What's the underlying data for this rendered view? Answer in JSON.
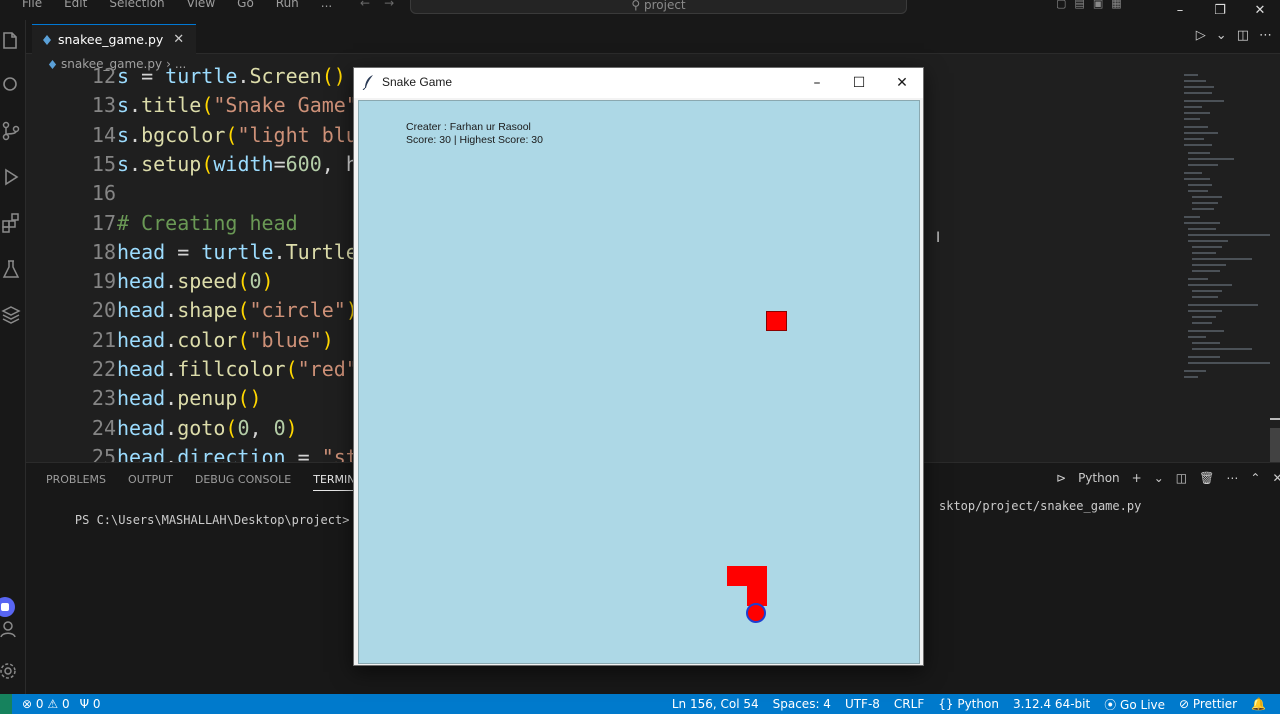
{
  "menubar": {
    "items": [
      "File",
      "Edit",
      "Selection",
      "View",
      "Go",
      "Run",
      "..."
    ],
    "search_text": "project"
  },
  "tab": {
    "filename": "snakee_game.py"
  },
  "breadcrumb": {
    "file": "snakee_game.py",
    "rest": "..."
  },
  "code_lines": [
    {
      "num": "12",
      "tokens": [
        {
          "t": "s",
          "c": "var"
        },
        {
          "t": " = ",
          "c": ""
        },
        {
          "t": "turtle",
          "c": "var"
        },
        {
          "t": ".",
          "c": ""
        },
        {
          "t": "Screen",
          "c": "fn"
        },
        {
          "t": "()",
          "c": "br1"
        }
      ]
    },
    {
      "num": "13",
      "tokens": [
        {
          "t": "s",
          "c": "var"
        },
        {
          "t": ".",
          "c": ""
        },
        {
          "t": "title",
          "c": "fn"
        },
        {
          "t": "(",
          "c": "br1"
        },
        {
          "t": "\"Snake Game\"",
          "c": "str"
        }
      ]
    },
    {
      "num": "14",
      "tokens": [
        {
          "t": "s",
          "c": "var"
        },
        {
          "t": ".",
          "c": ""
        },
        {
          "t": "bgcolor",
          "c": "fn"
        },
        {
          "t": "(",
          "c": "br1"
        },
        {
          "t": "\"light blu",
          "c": "str"
        }
      ]
    },
    {
      "num": "15",
      "tokens": [
        {
          "t": "s",
          "c": "var"
        },
        {
          "t": ".",
          "c": ""
        },
        {
          "t": "setup",
          "c": "fn"
        },
        {
          "t": "(",
          "c": "br1"
        },
        {
          "t": "width",
          "c": "var"
        },
        {
          "t": "=",
          "c": ""
        },
        {
          "t": "600",
          "c": "num"
        },
        {
          "t": ", h",
          "c": ""
        }
      ]
    },
    {
      "num": "16",
      "tokens": []
    },
    {
      "num": "17",
      "tokens": [
        {
          "t": "# Creating head",
          "c": "cmt"
        }
      ]
    },
    {
      "num": "18",
      "tokens": [
        {
          "t": "head",
          "c": "var"
        },
        {
          "t": " = ",
          "c": ""
        },
        {
          "t": "turtle",
          "c": "var"
        },
        {
          "t": ".",
          "c": ""
        },
        {
          "t": "Turtle",
          "c": "fn"
        }
      ]
    },
    {
      "num": "19",
      "tokens": [
        {
          "t": "head",
          "c": "var"
        },
        {
          "t": ".",
          "c": ""
        },
        {
          "t": "speed",
          "c": "fn"
        },
        {
          "t": "(",
          "c": "br1"
        },
        {
          "t": "0",
          "c": "num"
        },
        {
          "t": ")",
          "c": "br1"
        }
      ]
    },
    {
      "num": "20",
      "tokens": [
        {
          "t": "head",
          "c": "var"
        },
        {
          "t": ".",
          "c": ""
        },
        {
          "t": "shape",
          "c": "fn"
        },
        {
          "t": "(",
          "c": "br1"
        },
        {
          "t": "\"circle\"",
          "c": "str"
        },
        {
          "t": ")",
          "c": "br1"
        }
      ]
    },
    {
      "num": "21",
      "tokens": [
        {
          "t": "head",
          "c": "var"
        },
        {
          "t": ".",
          "c": ""
        },
        {
          "t": "color",
          "c": "fn"
        },
        {
          "t": "(",
          "c": "br1"
        },
        {
          "t": "\"blue\"",
          "c": "str"
        },
        {
          "t": ")",
          "c": "br1"
        }
      ]
    },
    {
      "num": "22",
      "tokens": [
        {
          "t": "head",
          "c": "var"
        },
        {
          "t": ".",
          "c": ""
        },
        {
          "t": "fillcolor",
          "c": "fn"
        },
        {
          "t": "(",
          "c": "br1"
        },
        {
          "t": "\"red\"",
          "c": "str"
        }
      ]
    },
    {
      "num": "23",
      "tokens": [
        {
          "t": "head",
          "c": "var"
        },
        {
          "t": ".",
          "c": ""
        },
        {
          "t": "penup",
          "c": "fn"
        },
        {
          "t": "()",
          "c": "br1"
        }
      ]
    },
    {
      "num": "24",
      "tokens": [
        {
          "t": "head",
          "c": "var"
        },
        {
          "t": ".",
          "c": ""
        },
        {
          "t": "goto",
          "c": "fn"
        },
        {
          "t": "(",
          "c": "br1"
        },
        {
          "t": "0",
          "c": "num"
        },
        {
          "t": ", ",
          "c": ""
        },
        {
          "t": "0",
          "c": "num"
        },
        {
          "t": ")",
          "c": "br1"
        }
      ]
    },
    {
      "num": "25",
      "tokens": [
        {
          "t": "head",
          "c": "var"
        },
        {
          "t": ".",
          "c": ""
        },
        {
          "t": "direction",
          "c": "var"
        },
        {
          "t": " = ",
          "c": ""
        },
        {
          "t": "\"st",
          "c": "str"
        }
      ]
    }
  ],
  "panel": {
    "tabs": [
      "PROBLEMS",
      "OUTPUT",
      "DEBUG CONSOLE",
      "TERMINAL"
    ],
    "active_tab": "TERMINAL",
    "shell": "Python",
    "terminal_prompt": "PS C:\\Users\\MASHALLAH\\Desktop\\project> & C:/Us",
    "terminal_tail": "sktop/project/snakee_game.py"
  },
  "statusbar": {
    "errors": "0",
    "warnings": "0",
    "ports": "0",
    "position": "Ln 156, Col 54",
    "spaces": "Spaces: 4",
    "encoding": "UTF-8",
    "eol": "CRLF",
    "language": "Python",
    "interpreter": "3.12.4 64-bit",
    "golive": "Go Live",
    "prettier": "Prettier"
  },
  "game": {
    "window_title": "Snake Game",
    "creator_line": "Creater : Farhan ur Rasool",
    "score_line": "Score: 30  |  Highest Score: 30",
    "colors": {
      "background": "#add8e6",
      "food": "#ff0000",
      "snake": "#ff0000",
      "head_outline": "#1f3fd0"
    }
  },
  "colors": {
    "accent": "#007acc",
    "editor_bg": "#1f1f1f"
  }
}
